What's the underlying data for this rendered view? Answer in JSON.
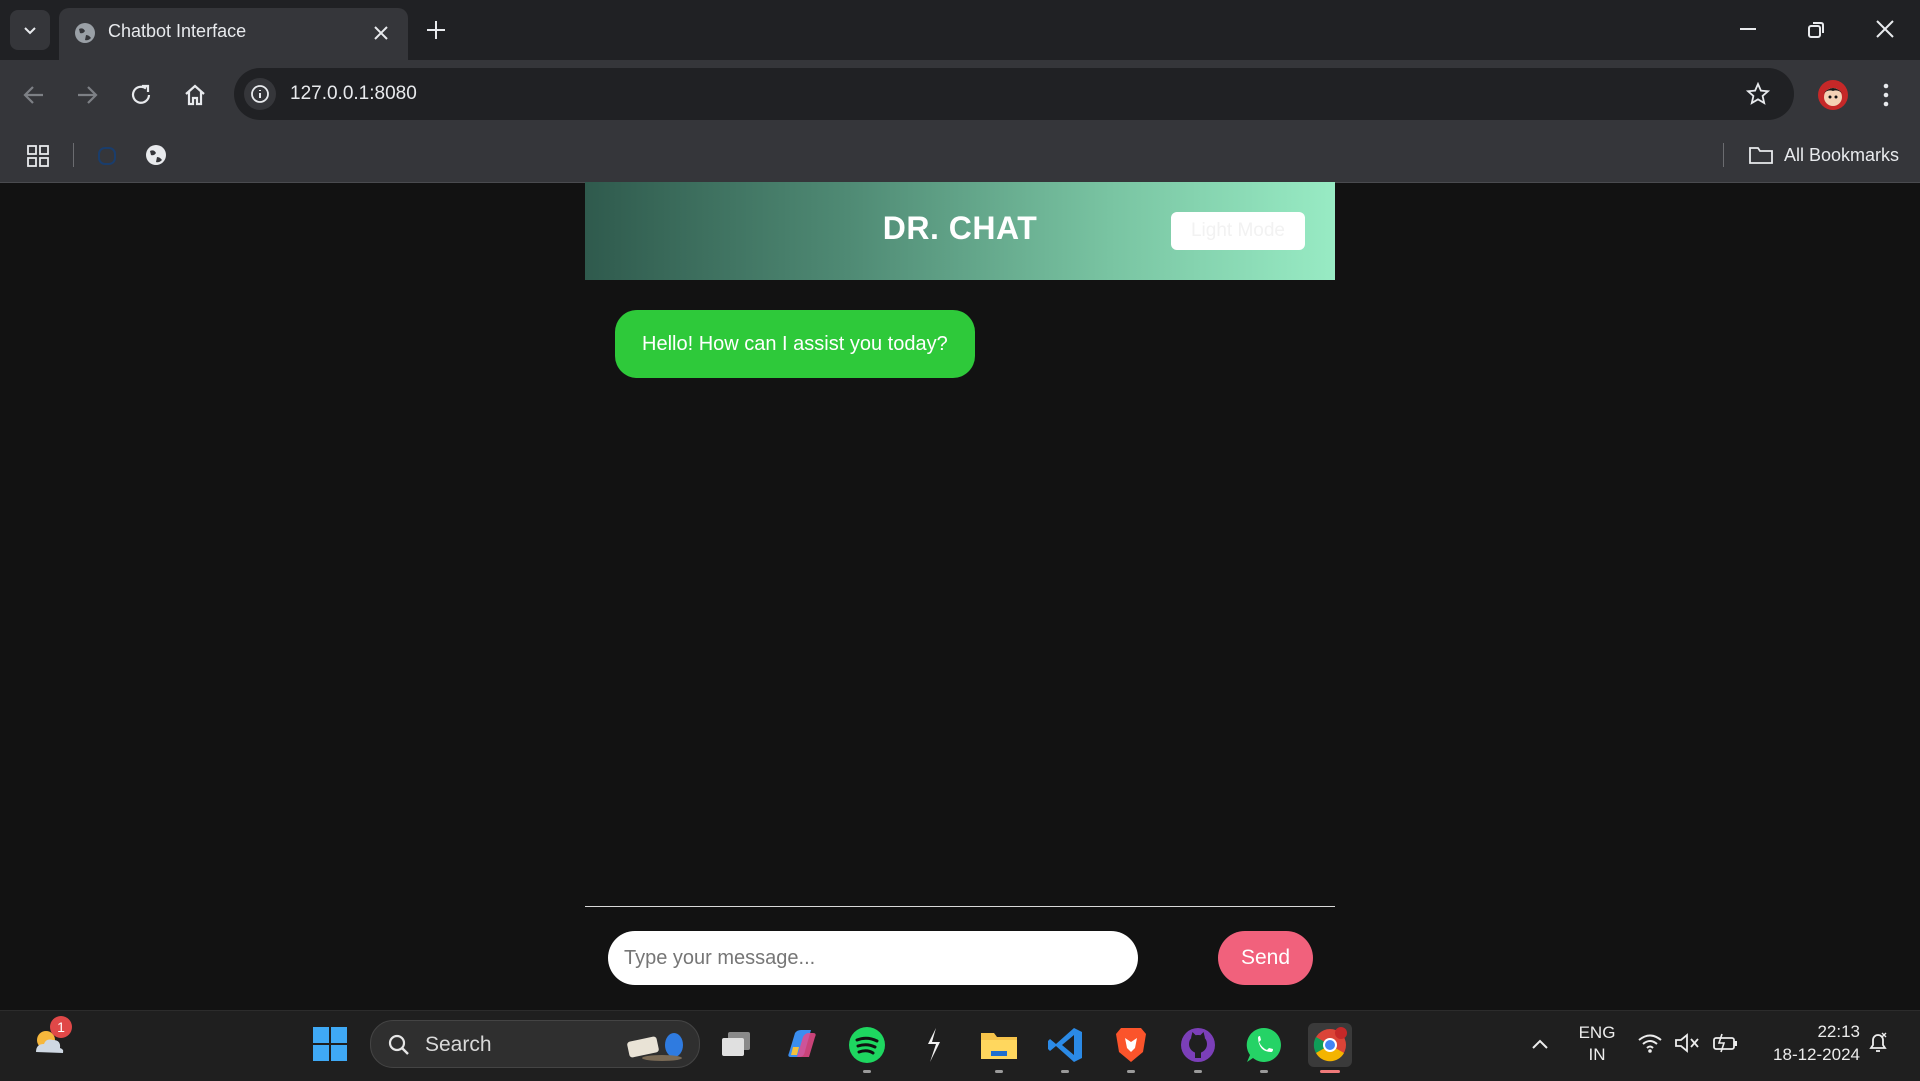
{
  "browser": {
    "tab": {
      "title": "Chatbot Interface"
    },
    "address_bar": {
      "url": "127.0.0.1:8080"
    },
    "bookmarks_bar": {
      "all_bookmarks_label": "All Bookmarks"
    },
    "icons": [
      "tab-list-icon",
      "globe-icon",
      "close-icon",
      "plus-icon",
      "minimize-icon",
      "restore-icon",
      "back-icon",
      "forward-icon",
      "reload-icon",
      "home-icon",
      "info-icon",
      "star-icon",
      "profile-avatar",
      "more-icon",
      "apps-icon",
      "folder-icon"
    ]
  },
  "app": {
    "header": {
      "title": "DR. CHAT",
      "theme_toggle_label": "Light Mode",
      "gradient_start": "#2f5a4d",
      "gradient_end": "#98ebc4"
    },
    "messages": [
      {
        "sender": "bot",
        "text": "Hello! How can I assist you today?",
        "bubble_color": "#2ec93a"
      }
    ],
    "composer": {
      "placeholder": "Type your message...",
      "value": "",
      "send_label": "Send",
      "send_color": "#f1617c"
    }
  },
  "taskbar": {
    "weather_badge": "1",
    "search_label": "Search",
    "pinned_apps": [
      "task-view",
      "copilot",
      "spotify",
      "cursor-app",
      "file-explorer",
      "vscode",
      "brave",
      "github-desktop",
      "whatsapp",
      "chrome"
    ],
    "language": {
      "line1": "ENG",
      "line2": "IN"
    },
    "clock": {
      "time": "22:13",
      "date": "18-12-2024"
    }
  }
}
